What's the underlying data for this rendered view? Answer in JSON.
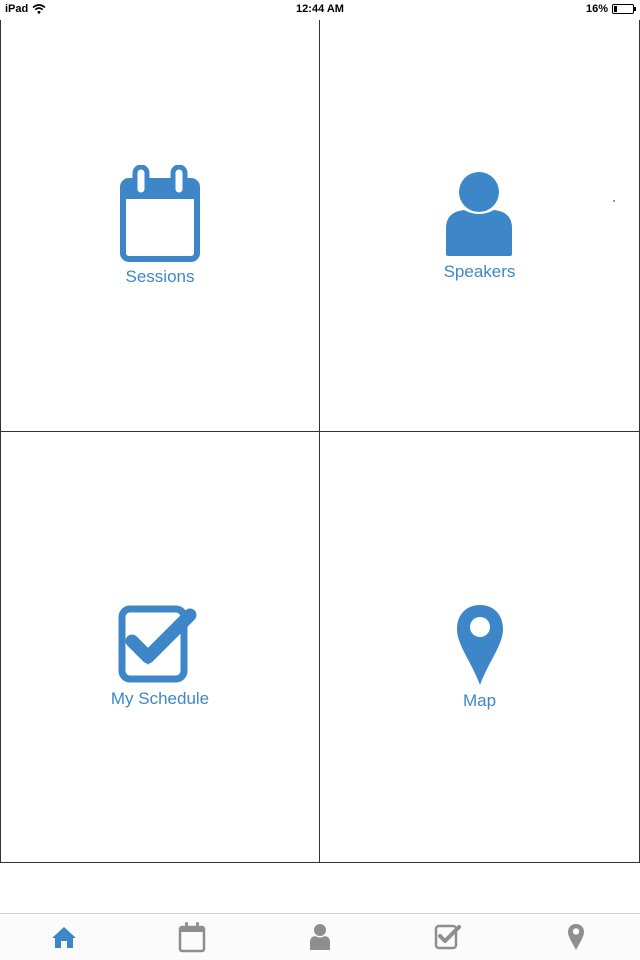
{
  "status_bar": {
    "device": "iPad",
    "time": "12:44 AM",
    "battery_percent": "16%",
    "battery_level": 0.16
  },
  "colors": {
    "accent": "#3d87c8",
    "tab_inactive": "#8e8e8e",
    "tab_active": "#3d87c8"
  },
  "tiles": [
    {
      "label": "Sessions",
      "icon": "calendar-icon"
    },
    {
      "label": "Speakers",
      "icon": "person-icon"
    },
    {
      "label": "My Schedule",
      "icon": "checkbox-icon"
    },
    {
      "label": "Map",
      "icon": "map-pin-icon"
    }
  ],
  "tab_bar": {
    "active_index": 0,
    "items": [
      {
        "icon": "home-icon"
      },
      {
        "icon": "calendar-icon"
      },
      {
        "icon": "person-icon"
      },
      {
        "icon": "checkbox-icon"
      },
      {
        "icon": "map-pin-icon"
      }
    ]
  }
}
